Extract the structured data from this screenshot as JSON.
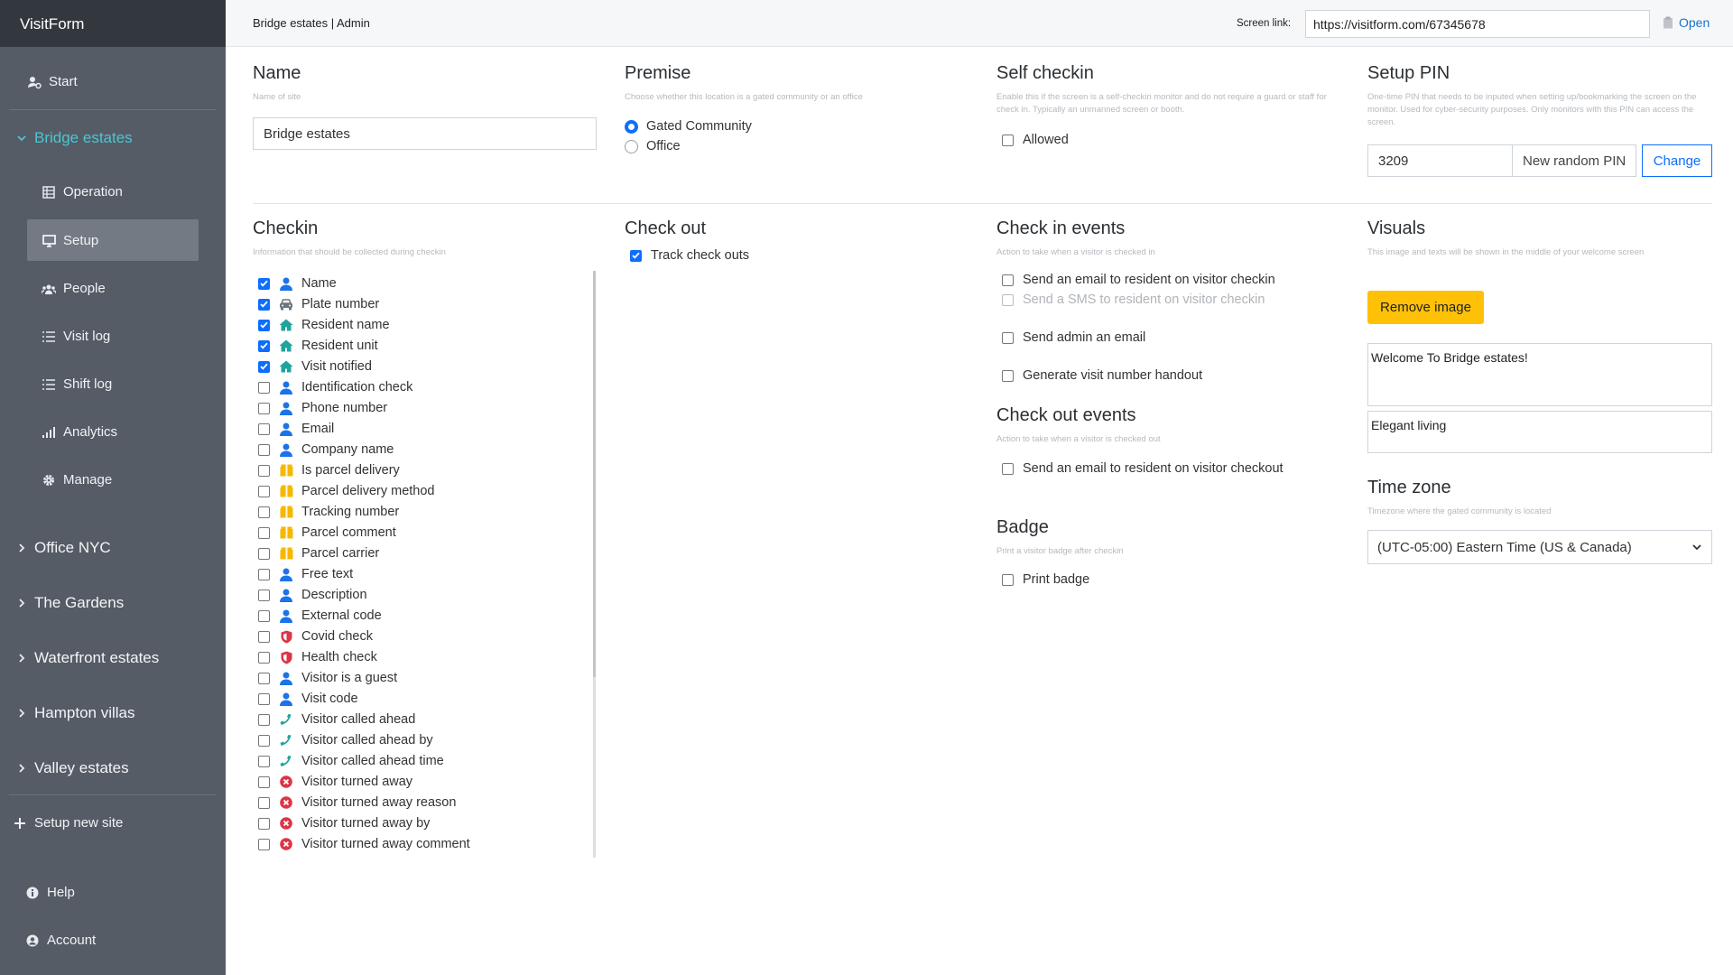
{
  "app": {
    "brand": "VisitForm"
  },
  "sidebar": {
    "start": "Start",
    "current_site": "Bridge estates",
    "sub_items": [
      "Operation",
      "Setup",
      "People",
      "Visit log",
      "Shift log",
      "Analytics",
      "Manage"
    ],
    "sites": [
      "Office NYC",
      "The Gardens",
      "Waterfront estates",
      "Hampton villas",
      "Valley estates"
    ],
    "setup_new": "Setup new site",
    "help": "Help",
    "account": "Account"
  },
  "topbar": {
    "breadcrumb": "Bridge estates | Admin",
    "screen_link_label": "Screen link:",
    "screen_link_value": "https://visitform.com/67345678",
    "open_label": "Open"
  },
  "name_section": {
    "title": "Name",
    "desc": "Name of site",
    "value": "Bridge estates"
  },
  "premise": {
    "title": "Premise",
    "desc": "Choose whether this location is a gated community or an office",
    "options": [
      "Gated Community",
      "Office"
    ],
    "selected": "Gated Community"
  },
  "self_checkin": {
    "title": "Self checkin",
    "desc": "Enable this if the screen is a self-checkin monitor and do not require a guard or staff for check in. Typically an unmanned screen or booth.",
    "option": "Allowed"
  },
  "setup_pin": {
    "title": "Setup PIN",
    "desc": "One-time PIN that needs to be inputed when setting up/bookmarking the screen on the monitor. Used for cyber-security purposes. Only monitors with this PIN can access the screen.",
    "value": "3209",
    "random_label": "New random PIN",
    "change_label": "Change"
  },
  "checkin": {
    "title": "Checkin",
    "desc": "Information that should be collected during checkin",
    "items": [
      {
        "label": "Name",
        "checked": true,
        "icon": "person-icon"
      },
      {
        "label": "Plate number",
        "checked": true,
        "icon": "car-icon"
      },
      {
        "label": "Resident name",
        "checked": true,
        "icon": "home-icon"
      },
      {
        "label": "Resident unit",
        "checked": true,
        "icon": "home-icon"
      },
      {
        "label": "Visit notified",
        "checked": true,
        "icon": "home-icon"
      },
      {
        "label": "Identification check",
        "checked": false,
        "icon": "person-icon"
      },
      {
        "label": "Phone number",
        "checked": false,
        "icon": "person-icon"
      },
      {
        "label": "Email",
        "checked": false,
        "icon": "person-icon"
      },
      {
        "label": "Company name",
        "checked": false,
        "icon": "person-icon"
      },
      {
        "label": "Is parcel delivery",
        "checked": false,
        "icon": "parcel-icon"
      },
      {
        "label": "Parcel delivery method",
        "checked": false,
        "icon": "parcel-icon"
      },
      {
        "label": "Tracking number",
        "checked": false,
        "icon": "parcel-icon"
      },
      {
        "label": "Parcel comment",
        "checked": false,
        "icon": "parcel-icon"
      },
      {
        "label": "Parcel carrier",
        "checked": false,
        "icon": "parcel-icon"
      },
      {
        "label": "Free text",
        "checked": false,
        "icon": "person-icon"
      },
      {
        "label": "Description",
        "checked": false,
        "icon": "person-icon"
      },
      {
        "label": "External code",
        "checked": false,
        "icon": "person-icon"
      },
      {
        "label": "Covid check",
        "checked": false,
        "icon": "shield-icon"
      },
      {
        "label": "Health check",
        "checked": false,
        "icon": "shield-icon"
      },
      {
        "label": "Visitor is a guest",
        "checked": false,
        "icon": "person-icon"
      },
      {
        "label": "Visit code",
        "checked": false,
        "icon": "person-icon"
      },
      {
        "label": "Visitor called ahead",
        "checked": false,
        "icon": "phone-icon"
      },
      {
        "label": "Visitor called ahead by",
        "checked": false,
        "icon": "phone-icon"
      },
      {
        "label": "Visitor called ahead time",
        "checked": false,
        "icon": "phone-icon"
      },
      {
        "label": "Visitor turned away",
        "checked": false,
        "icon": "x-circle-icon"
      },
      {
        "label": "Visitor turned away reason",
        "checked": false,
        "icon": "x-circle-icon"
      },
      {
        "label": "Visitor turned away by",
        "checked": false,
        "icon": "x-circle-icon"
      },
      {
        "label": "Visitor turned away comment",
        "checked": false,
        "icon": "x-circle-icon"
      }
    ]
  },
  "checkout": {
    "title": "Check out",
    "option": "Track check outs",
    "checked": true
  },
  "checkin_events": {
    "title": "Check in events",
    "desc": "Action to take when a visitor is checked in",
    "items": [
      {
        "label": "Send an email to resident on visitor checkin",
        "disabled": false
      },
      {
        "label": "Send a SMS to resident on visitor checkin",
        "disabled": true
      },
      {
        "label": "Send admin an email",
        "disabled": false
      },
      {
        "label": "Generate visit number handout",
        "disabled": false
      }
    ]
  },
  "checkout_events": {
    "title": "Check out events",
    "desc": "Action to take when a visitor is checked out",
    "option": "Send an email to resident on visitor checkout"
  },
  "badge": {
    "title": "Badge",
    "desc": "Print a visitor badge after checkin",
    "option": "Print badge"
  },
  "visuals": {
    "title": "Visuals",
    "desc": "This image and texts will be shown in the middle of your welcome screen",
    "remove_label": "Remove image",
    "welcome_text": "Welcome To Bridge estates!",
    "tagline": "Elegant living"
  },
  "timezone": {
    "title": "Time zone",
    "desc": "Timezone where the gated community is located",
    "value": "(UTC-05:00) Eastern Time (US & Canada)"
  },
  "colors": {
    "sidebar": "#555c66",
    "brand_bar": "#33383f",
    "accent": "#0d6efd",
    "site_active": "#4ec5d0",
    "warning": "#ffc107"
  }
}
